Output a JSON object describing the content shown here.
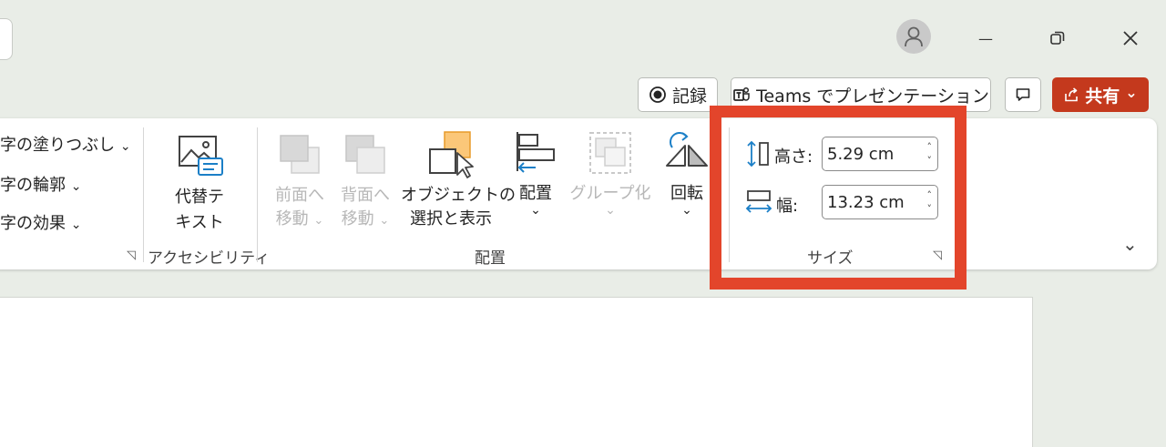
{
  "titlebar": {
    "minimize_glyph": "—",
    "restore_glyph": "❐",
    "close_glyph": "✕"
  },
  "actions": {
    "record_label": "記録",
    "teams_label": "Teams でプレゼンテーション",
    "share_label": "共有",
    "share_chevron": "⌄"
  },
  "ribbon": {
    "text_fill": "字の塗りつぶし",
    "text_outline": "字の輪郭",
    "text_effect": "字の効果",
    "alt_text_line1": "代替テ",
    "alt_text_line2": "キスト",
    "accessibility_group": "アクセシビリティ",
    "bring_forward_line1": "前面へ",
    "bring_forward_line2": "移動",
    "send_backward_line1": "背面へ",
    "send_backward_line2": "移動",
    "selection_pane_line1": "オブジェクトの",
    "selection_pane_line2": "選択と表示",
    "align_label": "配置",
    "group_label": "グループ化",
    "rotate_label": "回転",
    "arrange_group": "配置",
    "chevron": "⌄",
    "size": {
      "height_label": "高さ:",
      "height_value": "5.29 cm",
      "width_label": "幅:",
      "width_value": "13.23 cm",
      "group_label": "サイズ",
      "spin_up": "˄",
      "spin_down": "˅"
    },
    "launcher_glyph": "◹",
    "collapse_glyph": "⌄"
  },
  "colors": {
    "highlight": "#e3452b",
    "share_bg": "#c4391d",
    "accent_blue": "#1b7fc7"
  }
}
